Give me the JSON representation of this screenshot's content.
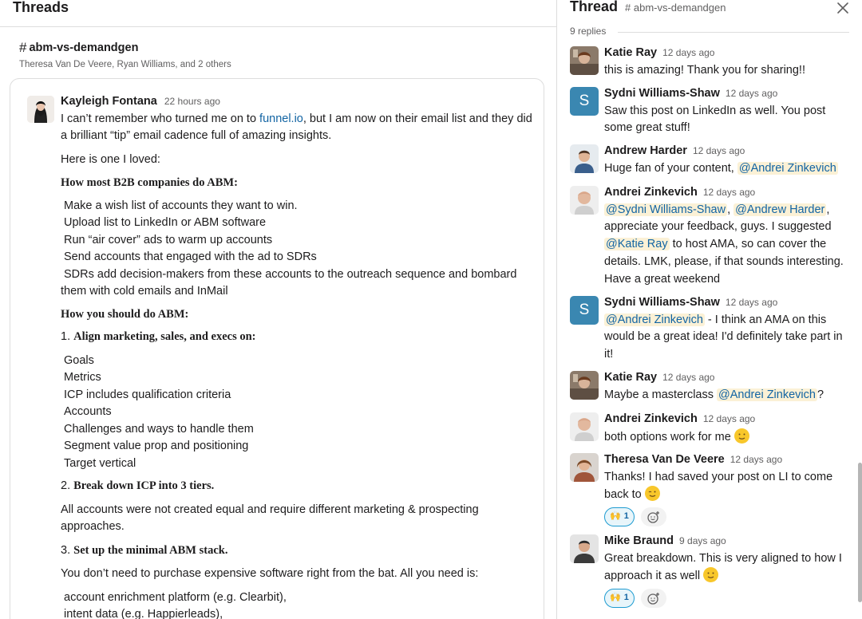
{
  "left": {
    "title": "Threads",
    "channel": "abm-vs-demandgen",
    "members": "Theresa Van De Veere, Ryan Williams, and 2 others"
  },
  "message": {
    "author": "Kayleigh Fontana",
    "time": "22 hours ago",
    "p1_pre": "I can’t remember who turned me on to ",
    "p1_link": "funnel.io",
    "p1_post": ", but I am now on their email list and they did a brilliant “tip” email cadence full of amazing insights.",
    "p2": "Here is one I loved:",
    "h1": "How most B2B companies do ABM:",
    "list1": [
      "Make a wish list of accounts they want to win.",
      "Upload list to LinkedIn or ABM software",
      "Run “air cover” ads to warm up accounts",
      "Send accounts that engaged with the ad to SDRs",
      "SDRs add decision-makers from these accounts to the outreach sequence and bombard them with cold emails and InMail"
    ],
    "h2": "How you should do ABM:",
    "step1_num": "1.",
    "step1": "Align marketing, sales, and execs on:",
    "list2": [
      "Goals",
      "Metrics",
      "ICP includes qualification criteria",
      "Accounts",
      "Challenges and ways to handle them",
      "Segment value prop and positioning",
      "Target vertical"
    ],
    "step2_num": "2.",
    "step2": "Break down ICP into 3 tiers.",
    "p3": "All accounts were not created equal and require different marketing & prospecting approaches.",
    "step3_num": "3.",
    "step3": "Set up the minimal ABM stack.",
    "p4": "You don’t need to purchase expensive software right from the bat. All you need is:",
    "list3": [
      "account enrichment platform (e.g. Clearbit),",
      "intent data (e.g. Happierleads),"
    ]
  },
  "thread": {
    "title": "Thread",
    "channel": "abm-vs-demandgen",
    "replies_count": "9 replies",
    "replies": [
      {
        "name": "Katie Ray",
        "time": "12 days ago",
        "text": "this is amazing! Thank you for sharing!!"
      },
      {
        "name": "Sydni Williams-Shaw",
        "time": "12 days ago",
        "initial": "S",
        "text": "Saw this post on LinkedIn as well. You post some great stuff!"
      },
      {
        "name": "Andrew Harder",
        "time": "12 days ago",
        "text": "Huge fan of your content, ",
        "mention": "@Andrei Zinkevich"
      },
      {
        "name": "Andrei Zinkevich",
        "time": "12 days ago",
        "m1": "@Sydni Williams-Shaw",
        "sep": ", ",
        "m2": "@Andrew Harder",
        "t1": ", appreciate your feedback, guys. I suggested ",
        "m3": "@Katie Ray",
        "t2": " to host AMA, so can cover the details. LMK, please, if that sounds interesting. Have a great weekend"
      },
      {
        "name": "Sydni Williams-Shaw",
        "time": "12 days ago",
        "initial": "S",
        "mention": "@Andrei Zinkevich",
        "text": " - I think an AMA on this would be a great idea! I'd definitely take part in it!"
      },
      {
        "name": "Katie Ray",
        "time": "12 days ago",
        "text": "Maybe a masterclass ",
        "mention": "@Andrei Zinkevich",
        "post": "?"
      },
      {
        "name": "Andrei Zinkevich",
        "time": "12 days ago",
        "text": "both options work for me"
      },
      {
        "name": "Theresa Van De Veere",
        "time": "12 days ago",
        "text": "Thanks! I had saved your post on LI to come back to",
        "reaction_count": "1"
      },
      {
        "name": "Mike Braund",
        "time": "9 days ago",
        "text": "Great breakdown. This is very aligned to how I approach it as well",
        "reaction_count": "1"
      }
    ]
  },
  "icons": {
    "close": "close-icon",
    "add_reaction": "add-reaction-icon",
    "hash": "hash-icon"
  }
}
